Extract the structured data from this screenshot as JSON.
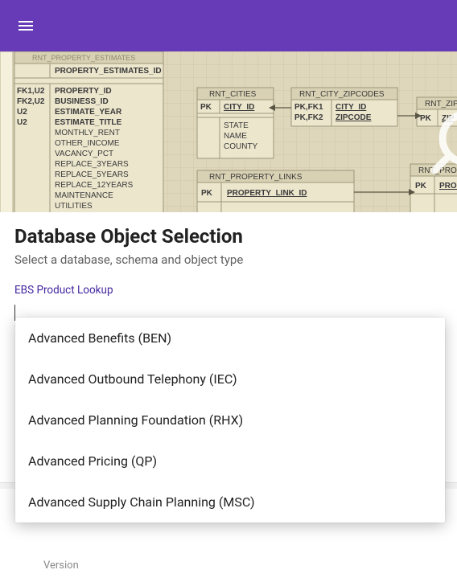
{
  "header": {},
  "hero_diagram": {
    "tables": [
      {
        "name": "RNT_PROPERTY_ESTIMATES",
        "pk": "PROPERTY_ESTIMATES_ID",
        "rows": [
          {
            "flags": "FK1,U2",
            "col": "PROPERTY_ID"
          },
          {
            "flags": "FK2,U2",
            "col": "BUSINESS_ID"
          },
          {
            "flags": "U2",
            "col": "ESTIMATE_YEAR"
          },
          {
            "flags": "U2",
            "col": "ESTIMATE_TITLE"
          },
          {
            "flags": "",
            "col": "MONTHLY_RENT"
          },
          {
            "flags": "",
            "col": "OTHER_INCOME"
          },
          {
            "flags": "",
            "col": "VACANCY_PCT"
          },
          {
            "flags": "",
            "col": "REPLACE_3YEARS"
          },
          {
            "flags": "",
            "col": "REPLACE_5YEARS"
          },
          {
            "flags": "",
            "col": "REPLACE_12YEARS"
          },
          {
            "flags": "",
            "col": "MAINTENANCE"
          },
          {
            "flags": "",
            "col": "UTILITIES"
          }
        ]
      },
      {
        "name": "RNT_CITIES",
        "pk_flag": "PK",
        "pk": "CITY_ID",
        "cols": [
          "STATE",
          "NAME",
          "COUNTY"
        ]
      },
      {
        "name": "RNT_CITY_ZIPCODES",
        "rows": [
          {
            "flags": "PK,FK1",
            "col": "CITY_ID"
          },
          {
            "flags": "PK,FK2",
            "col": "ZIPCODE"
          }
        ]
      },
      {
        "name": "RNT_ZIP",
        "rows": [
          {
            "flags": "PK",
            "col": "ZIP"
          }
        ]
      },
      {
        "name": "RNT_PROPERTY_LINKS",
        "pk_flag": "PK",
        "pk": "PROPERTY_LINK_ID"
      },
      {
        "name": "RNT_PROP",
        "pk_flag": "PK",
        "pk": "PROPER"
      }
    ]
  },
  "main": {
    "title": "Database Object Selection",
    "subtitle": "Select a database, schema and object type",
    "lookup_link": "EBS Product Lookup",
    "input_value": ""
  },
  "dropdown": {
    "items": [
      "Advanced Benefits (BEN)",
      "Advanced Outbound Telephony (IEC)",
      "Advanced Planning Foundation (RHX)",
      "Advanced Pricing (QP)",
      "Advanced Supply Chain Planning (MSC)"
    ]
  },
  "below": {
    "version_label": "Version"
  }
}
